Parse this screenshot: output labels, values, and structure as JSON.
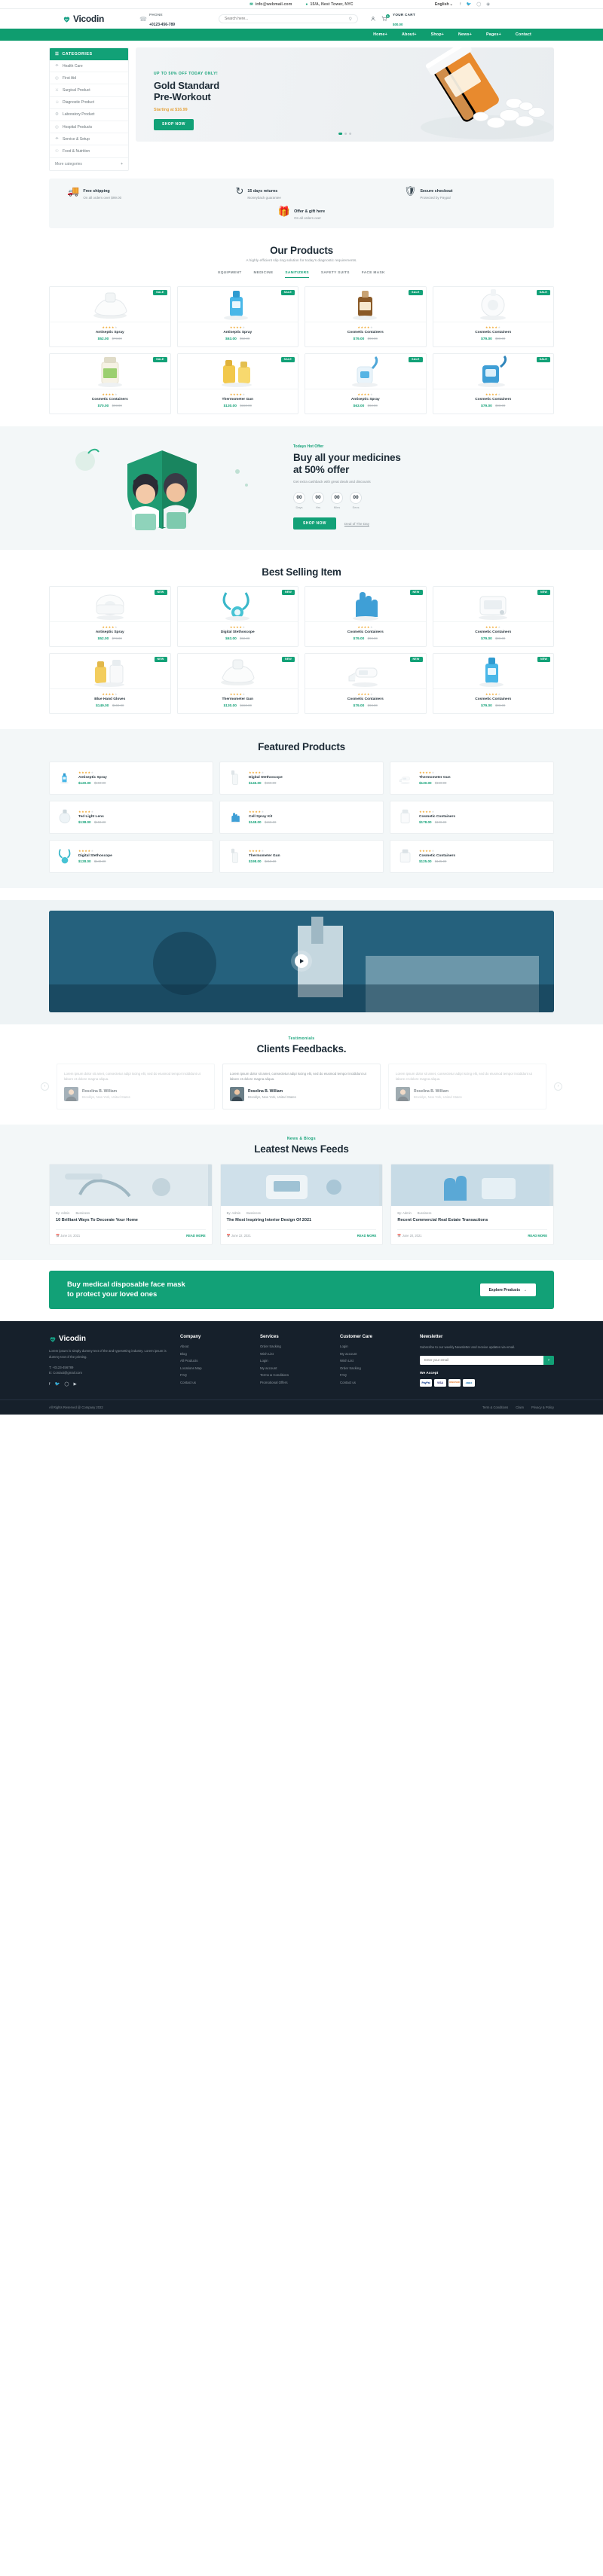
{
  "topbar": {
    "email": "info@webmail.com",
    "address": "15/A, Nest Tower, NYC",
    "language": "English",
    "socials": [
      "facebook-icon",
      "twitter-icon",
      "instagram-icon",
      "dribbble-icon"
    ]
  },
  "header": {
    "logo": "Vicodin",
    "phone_label": "PHONE",
    "phone_number": "+0123-456-789",
    "search_placeholder": "Search here...",
    "cart_label": "YOUR CART",
    "cart_price": "$00.00",
    "cart_count": "0"
  },
  "nav": {
    "items": [
      "Home+",
      "About+",
      "Shop+",
      "News+",
      "Pages+",
      "Contact"
    ]
  },
  "categories": {
    "title": "CATEGORIES",
    "items": [
      "Health Care",
      "First Aid",
      "Surgical Product",
      "Diagnostic Product",
      "Laboratory Product",
      "Hospital Products",
      "Service & Setup",
      "Food & Nutrition"
    ],
    "more": "More categories"
  },
  "hero": {
    "eyebrow": "UP TO 50% OFF TODAY ONLY!",
    "title_line1": "Gold Standard",
    "title_line2": "Pre-Workout",
    "price": "Starting at $16.99",
    "button": "SHOP NOW"
  },
  "features": [
    {
      "icon": "truck-icon",
      "title": "Free shipping",
      "sub": "On all orders over $99.00"
    },
    {
      "icon": "refresh-icon",
      "title": "15 days returns",
      "sub": "Moneyback guarantee"
    },
    {
      "icon": "shield-icon",
      "title": "Secure checkout",
      "sub": "Protected by Paypal"
    },
    {
      "icon": "gift-icon",
      "title": "Offer & gift here",
      "sub": "On all orders over"
    }
  ],
  "products_section": {
    "title": "Our Products",
    "subtitle": "A highly efficient slip ring solution for today's diagnostic requirements.",
    "tabs": [
      "EQUIPMENT",
      "MEDICINE",
      "SANITIZERS",
      "SAFETY SUITS",
      "FACE MASK"
    ],
    "active_tab": "SANITIZERS",
    "items": [
      {
        "name": "Antiseptic Spray",
        "price_new": "$52.00",
        "price_old": "$78.00",
        "badge": "SALE",
        "img": "white-inhaler"
      },
      {
        "name": "Antiseptic Spray",
        "price_new": "$63.00",
        "price_old": "$92.00",
        "badge": "SALE",
        "img": "blue-spray"
      },
      {
        "name": "Cosmetic Containers",
        "price_new": "$79.00",
        "price_old": "$98.00",
        "badge": "SALE",
        "img": "brown-bottle"
      },
      {
        "name": "Cosmetic Containers",
        "price_new": "$79.00",
        "price_old": "$98.00",
        "badge": "SALE",
        "img": "white-device"
      },
      {
        "name": "Cosmetic Containers",
        "price_new": "$70.00",
        "price_old": "$98.00",
        "badge": "SALE",
        "img": "supplement-jar"
      },
      {
        "name": "Thermometer Gun",
        "price_new": "$130.00",
        "price_old": "$150.00",
        "badge": "SALE",
        "img": "yellow-bottles"
      },
      {
        "name": "Antiseptic Spray",
        "price_new": "$63.00",
        "price_old": "$92.00",
        "badge": "SALE",
        "img": "water-flosser"
      },
      {
        "name": "Cosmetic Containers",
        "price_new": "$79.00",
        "price_old": "$98.00",
        "badge": "SALE",
        "img": "blue-flosser"
      }
    ]
  },
  "promo": {
    "eyebrow": "Todays Hot Offer",
    "title_line1": "Buy all your medicines",
    "title_line2": "at 50% offer",
    "desc": "Get extra cashback with great deals and discounts",
    "countdown": [
      {
        "value": "00",
        "label": "Days"
      },
      {
        "value": "00",
        "label": "Hrs"
      },
      {
        "value": "00",
        "label": "Mins"
      },
      {
        "value": "00",
        "label": "Secs"
      }
    ],
    "button": "SHOP NOW",
    "link": "Deal of The Day"
  },
  "best_selling": {
    "title": "Best Selling Item",
    "items": [
      {
        "name": "Antiseptic Spray",
        "price_new": "$52.00",
        "price_old": "$78.00",
        "badge": "NEW",
        "img": "bandage-roll"
      },
      {
        "name": "Digital Stethoscope",
        "price_new": "$63.00",
        "price_old": "$92.00",
        "badge": "NEW",
        "img": "teal-stethoscope"
      },
      {
        "name": "Cosmetic Containers",
        "price_new": "$79.00",
        "price_old": "$98.00",
        "badge": "NEW",
        "img": "blue-gloves"
      },
      {
        "name": "Cosmetic Containers",
        "price_new": "$79.00",
        "price_old": "$98.00",
        "badge": "NEW",
        "img": "bp-monitor"
      },
      {
        "name": "Blue Hand Gloves",
        "price_new": "$149.00",
        "price_old": "$169.00",
        "badge": "NEW",
        "img": "pill-bottles"
      },
      {
        "name": "Thermometer Gun",
        "price_new": "$130.00",
        "price_old": "$150.00",
        "badge": "NEW",
        "img": "white-inhaler"
      },
      {
        "name": "Cosmetic Containers",
        "price_new": "$79.00",
        "price_old": "$98.00",
        "badge": "NEW",
        "img": "thermometer"
      },
      {
        "name": "Cosmetic Containers",
        "price_new": "$79.00",
        "price_old": "$98.00",
        "badge": "NEW",
        "img": "blue-spray"
      }
    ]
  },
  "featured": {
    "title": "Featured Products",
    "items": [
      {
        "name": "Antiseptic Spray",
        "price_new": "$120.00",
        "price_old": "$150.00",
        "img": "blue-spray"
      },
      {
        "name": "Digital Stethoscope",
        "price_new": "$145.00",
        "price_old": "$165.00",
        "img": "white-spray"
      },
      {
        "name": "Thermometer Gun",
        "price_new": "$130.00",
        "price_old": "$150.00",
        "img": "thermometer"
      },
      {
        "name": "Ted Light Lens",
        "price_new": "$138.00",
        "price_old": "$158.00",
        "img": "led-lens"
      },
      {
        "name": "Cell Spray Kit",
        "price_new": "$148.00",
        "price_old": "$168.00",
        "img": "blue-gloves"
      },
      {
        "name": "Cosmetic Containers",
        "price_new": "$178.00",
        "price_old": "$198.00",
        "img": "containers"
      },
      {
        "name": "Digital Stethoscope",
        "price_new": "$128.00",
        "price_old": "$148.00",
        "img": "stethoscope"
      },
      {
        "name": "Thermometer Gun",
        "price_new": "$198.00",
        "price_old": "$218.00",
        "img": "white-spray"
      },
      {
        "name": "Cosmetic Containers",
        "price_new": "$125.00",
        "price_old": "$145.00",
        "img": "containers2"
      }
    ]
  },
  "testimonials": {
    "eyebrow": "Testimonials",
    "title": "Clients Feedbacks.",
    "items": [
      {
        "text": "Lorem ipsum dolor sit amet, consectetur adipi iscing elit, sed do eiusmod tempor incididunt ut labore et dolore magna aliqua.",
        "name": "Roselina B. William",
        "address": "Brooklyn, New York, United States"
      },
      {
        "text": "Lorem ipsum dolor sit amet, consectetur adipi iscing elit, sed do eiusmod tempor incididunt ut labore et dolore magna aliqua.",
        "name": "Roselina B. William",
        "address": "Brooklyn, New York, United States"
      },
      {
        "text": "Lorem ipsum dolor sit amet, consectetur adipi iscing elit, sed do eiusmod tempor incididunt ut labore et dolore magna aliqua.",
        "name": "Roselina B. William",
        "address": "Brooklyn, New York, United States"
      }
    ]
  },
  "news": {
    "eyebrow": "News & Blogs",
    "title": "Leatest News Feeds",
    "items": [
      {
        "author": "By: Admin",
        "category": "Bussiness",
        "title": "10 Brilliant Ways To Decorate Your Home",
        "date": "June 24, 2021",
        "read": "READ MORE"
      },
      {
        "author": "By: Admin",
        "category": "Bussiness",
        "title": "The Most Inspiring Interior Design Of 2021",
        "date": "June 22, 2021",
        "read": "READ MORE"
      },
      {
        "author": "By: Admin",
        "category": "Bussiness",
        "title": "Recent Commercial Real Estate Transactions",
        "date": "June 20, 2021",
        "read": "READ MORE"
      }
    ]
  },
  "cta": {
    "line1": "Buy medical disposable face mask",
    "line2": "to protect your loved ones",
    "button": "Explore Products"
  },
  "footer": {
    "logo": "Vicodin",
    "desc": "Lorem ipsum is simply dummy text of the and typesetting industry. Lorem ipsum is dummy text of the printing.",
    "contact_phone": "T: +0123-456789",
    "contact_email": "E: Contact@gmail.com",
    "columns": [
      {
        "heading": "Company",
        "links": [
          "About",
          "Blog",
          "All Products",
          "Locations Map",
          "FAQ",
          "Contact us"
        ]
      },
      {
        "heading": "Services",
        "links": [
          "Order tracking",
          "Wish List",
          "Login",
          "My account",
          "Terms & Conditions",
          "Promotional Offers"
        ]
      },
      {
        "heading": "Customer Care",
        "links": [
          "Login",
          "My account",
          "Wish List",
          "Order tracking",
          "FAQ",
          "Contact us"
        ]
      }
    ],
    "newsletter": {
      "heading": "Newsletter",
      "sub": "Subscribe to our weekly Newsletter and receive updates via email.",
      "placeholder": "Enter your email",
      "accept_label": "We Accept",
      "payments": [
        "PayPal",
        "VISA",
        "DISCOVER",
        "AMEX"
      ]
    },
    "copyright": "All Rights Reserved @ Company 2022",
    "bottom_links": [
      "Term & Conditions",
      "Claim",
      "Privacy & Policy"
    ]
  },
  "colors": {
    "brand_green": "#12a177",
    "nav_green": "#0f9d6f",
    "dark": "#16202b",
    "star": "#f0a830"
  }
}
